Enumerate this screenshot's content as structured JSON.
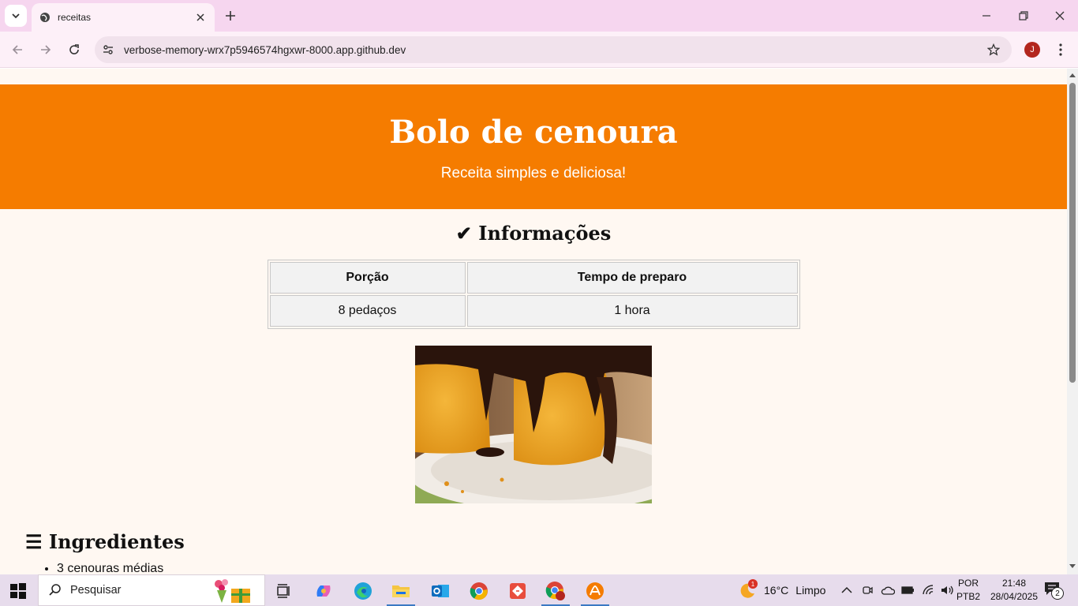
{
  "browser": {
    "tab_title": "receitas",
    "url": "verbose-memory-wrx7p5946574hgxwr-8000.app.github.dev",
    "profile_initial": "J"
  },
  "page": {
    "title": "Bolo de cenoura",
    "subtitle": "Receita simples e deliciosa!",
    "info_heading": "✔ Informações",
    "info_table": {
      "headers": [
        "Porção",
        "Tempo de preparo"
      ],
      "rows": [
        [
          "8 pedaços",
          "1 hora"
        ]
      ]
    },
    "ingredients_heading": "☰ Ingredientes",
    "ingredients": [
      "3 cenouras médias"
    ]
  },
  "taskbar": {
    "search_placeholder": "Pesquisar",
    "weather_temp": "16°C",
    "weather_text": "Limpo",
    "weather_badge": "1",
    "lang_line1": "POR",
    "lang_line2": "PTB2",
    "time": "21:48",
    "date": "28/04/2025",
    "notification_count": "2"
  },
  "colors": {
    "hero": "#f57c00",
    "page_bg": "#fff8f2",
    "tab_strip": "#f6d6ef"
  }
}
